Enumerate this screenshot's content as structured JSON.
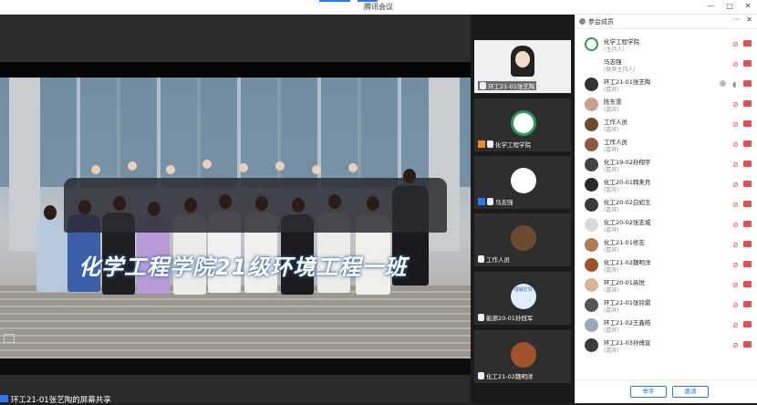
{
  "window": {
    "title": "腾讯会议",
    "controls": {
      "minimize": "—",
      "restore": "□",
      "close": "✕"
    }
  },
  "main_view": {
    "caption": "化学工程学院21级环境工程一班",
    "share_label": "环工21-01张艺陶的屏幕共享"
  },
  "video_tiles": [
    {
      "name": "环工21-01张艺陶",
      "badge": "mic"
    },
    {
      "name": "化学工程学院",
      "badge": "orange"
    },
    {
      "name": "马志强",
      "badge": "blue"
    },
    {
      "name": "工作人员",
      "badge": "mic"
    },
    {
      "name": "能源20-01孙冠军",
      "badge": "mic",
      "avatar_text": "成就打扑"
    },
    {
      "name": "化工21-02魏明洋",
      "badge": "mic"
    }
  ],
  "participants_panel": {
    "title": "参会成员",
    "more": "···",
    "close": "✕",
    "members": [
      {
        "name": "化学工程学院",
        "role": "(主持人)"
      },
      {
        "name": "马志强",
        "role": "(联席主持人)"
      },
      {
        "name": "环工21-01张艺陶",
        "role": "(嘉宾)"
      },
      {
        "name": "陈东雪",
        "role": "(嘉宾)"
      },
      {
        "name": "工作人员",
        "role": "(嘉宾)"
      },
      {
        "name": "工作人员",
        "role": "(嘉宾)"
      },
      {
        "name": "化工19-02孙翔宇",
        "role": "(嘉宾)"
      },
      {
        "name": "化工20-01韩来月",
        "role": "(嘉宾)"
      },
      {
        "name": "化工20-02白如玉",
        "role": "(嘉宾)"
      },
      {
        "name": "化工20-02张志城",
        "role": "(嘉宾)"
      },
      {
        "name": "化工21-01修志",
        "role": "(嘉宾)"
      },
      {
        "name": "化工21-02魏明洋",
        "role": "(嘉宾)"
      },
      {
        "name": "环工20-01高悦",
        "role": "(嘉宾)"
      },
      {
        "name": "环工21-01张铃鼎",
        "role": "(嘉宾)"
      },
      {
        "name": "环工21-02王鑫皓",
        "role": "(嘉宾)"
      },
      {
        "name": "环工21-03孙傅宣",
        "role": "(嘉宾)"
      }
    ],
    "buttons": {
      "raise_hand": "举手",
      "invite": "邀请"
    }
  },
  "colors": {
    "accent": "#2b78f5",
    "muted_red": "#e05050",
    "panel_bg": "#ffffff",
    "stage_bg": "#1f1f1f"
  }
}
